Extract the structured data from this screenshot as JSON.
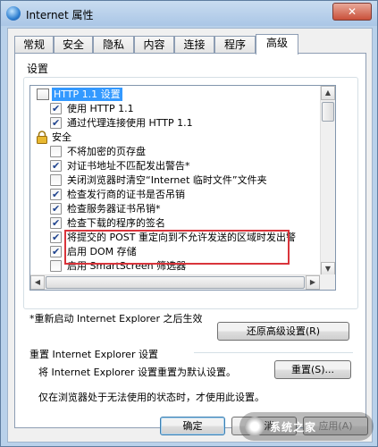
{
  "window": {
    "title": "Internet 属性",
    "close": "✕"
  },
  "tabs": [
    {
      "label": "常规"
    },
    {
      "label": "安全"
    },
    {
      "label": "隐私"
    },
    {
      "label": "内容"
    },
    {
      "label": "连接"
    },
    {
      "label": "程序"
    },
    {
      "label": "高级"
    }
  ],
  "settings": {
    "group_label": "设置",
    "items": [
      {
        "label": "HTTP 1.1 设置",
        "type": "folder",
        "selected": true
      },
      {
        "label": "使用 HTTP 1.1",
        "type": "checkbox",
        "checked": true
      },
      {
        "label": "通过代理连接使用 HTTP 1.1",
        "type": "checkbox",
        "checked": true
      },
      {
        "label": "安全",
        "type": "lock"
      },
      {
        "label": "不将加密的页存盘",
        "type": "checkbox",
        "checked": false
      },
      {
        "label": "对证书地址不匹配发出警告*",
        "type": "checkbox",
        "checked": true
      },
      {
        "label": "关闭浏览器时清空“Internet 临时文件”文件夹",
        "type": "checkbox",
        "checked": false
      },
      {
        "label": "检查发行商的证书是否吊销",
        "type": "checkbox",
        "checked": true
      },
      {
        "label": "检查服务器证书吊销*",
        "type": "checkbox",
        "checked": true
      },
      {
        "label": "检查下载的程序的签名",
        "type": "checkbox",
        "checked": true
      },
      {
        "label": "将提交的 POST 重定向到不允许发送的区域时发出警",
        "type": "checkbox",
        "checked": true
      },
      {
        "label": "启用 DOM 存储",
        "type": "checkbox",
        "checked": true
      },
      {
        "label": "启用 SmartScreen 筛选器",
        "type": "checkbox",
        "checked": false
      }
    ],
    "note": "*重新启动 Internet Explorer 之后生效",
    "restore_button": "还原高级设置(R)"
  },
  "reset": {
    "title": "重置 Internet Explorer 设置",
    "description": "将 Internet Explorer 设置重置为默认设置。",
    "button": "重置(S)...",
    "warning": "仅在浏览器处于无法使用的状态时，才使用此设置。"
  },
  "footer": {
    "ok": "确定",
    "cancel": "取消",
    "apply": "应用(A)"
  },
  "watermark": {
    "text": "系统之家"
  },
  "colors": {
    "highlight": "#3399ff",
    "annotation": "#d9343b"
  }
}
